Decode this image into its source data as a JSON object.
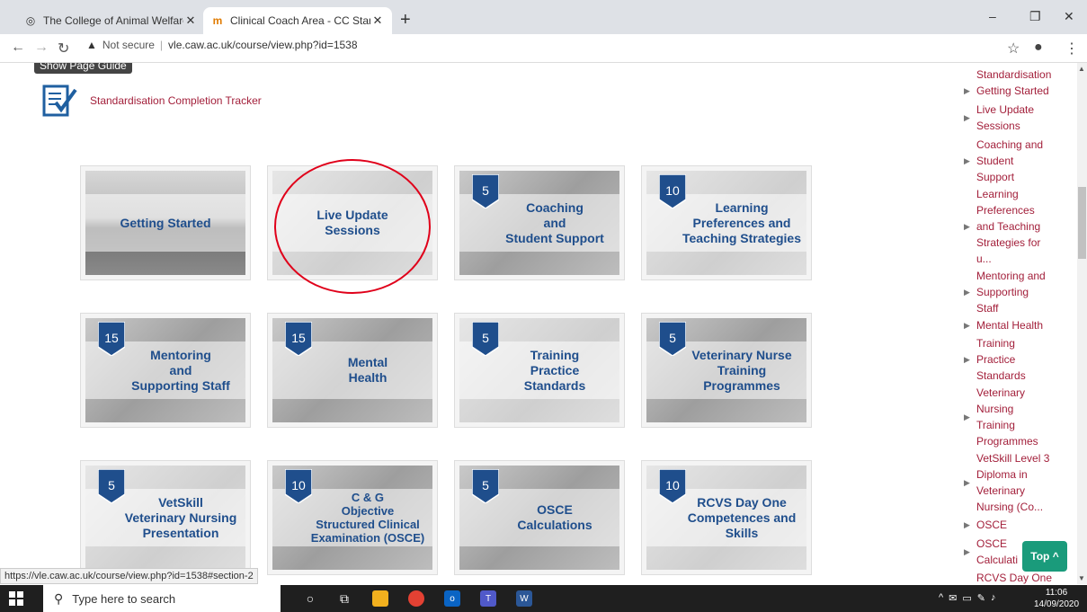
{
  "browser": {
    "tabs": [
      {
        "title": "The College of Animal Welfare",
        "active": false
      },
      {
        "title": "Clinical Coach Area - CC Standar",
        "active": true
      }
    ],
    "new_tab_label": "+",
    "minimize": "–",
    "maximize": "❐",
    "close": "✕",
    "security_label": "Not secure",
    "url": "vle.caw.ac.uk/course/view.php?id=1538"
  },
  "page": {
    "guide_tip": "Show Page Guide",
    "tracker_link": "Standardisation Completion Tracker",
    "tiles": [
      {
        "label": "Getting Started",
        "badge": ""
      },
      {
        "label": "Live Update\nSessions",
        "badge": ""
      },
      {
        "label": "Coaching\nand\nStudent Support",
        "badge": "5"
      },
      {
        "label": "Learning\nPreferences and\nTeaching Strategies",
        "badge": "10"
      },
      {
        "label": "Mentoring\nand\nSupporting Staff",
        "badge": "15"
      },
      {
        "label": "Mental\nHealth",
        "badge": "15"
      },
      {
        "label": "Training\nPractice\nStandards",
        "badge": "5"
      },
      {
        "label": "Veterinary Nurse\nTraining\nProgrammes",
        "badge": "5"
      },
      {
        "label": "VetSkill\nVeterinary Nursing\nPresentation",
        "badge": "5"
      },
      {
        "label": "C & G\nObjective\nStructured Clinical\nExamination (OSCE)",
        "badge": "10"
      },
      {
        "label": "OSCE\nCalculations",
        "badge": "5"
      },
      {
        "label": "RCVS Day One\nCompetences and\nSkills",
        "badge": "10"
      }
    ],
    "status_url": "https://vle.caw.ac.uk/course/view.php?id=1538#section-2",
    "top_button": "Top ^"
  },
  "sidebar": {
    "items": [
      {
        "label": "Standardisation",
        "arrow": false
      },
      {
        "label": "Getting Started",
        "arrow": true
      },
      {
        "label": "Live Update\nSessions",
        "arrow": true
      },
      {
        "label": "Coaching and\nStudent\nSupport",
        "arrow": true
      },
      {
        "label": "Learning\nPreferences\nand Teaching\nStrategies for\nu...",
        "arrow": true
      },
      {
        "label": "Mentoring and\nSupporting\nStaff",
        "arrow": true
      },
      {
        "label": "Mental Health",
        "arrow": true
      },
      {
        "label": "Training\nPractice\nStandards",
        "arrow": true
      },
      {
        "label": "Veterinary\nNursing\nTraining\nProgrammes",
        "arrow": true
      },
      {
        "label": "VetSkill Level 3\nDiploma in\nVeterinary\nNursing (Co...",
        "arrow": true
      },
      {
        "label": "OSCE",
        "arrow": true
      },
      {
        "label": "OSCE\nCalculati",
        "arrow": true
      },
      {
        "label": "RCVS Day One",
        "arrow": false
      }
    ]
  },
  "taskbar": {
    "search_placeholder": "Type here to search",
    "time": "11:06",
    "date": "14/09/2020"
  },
  "colors": {
    "link": "#a3203b",
    "tile_text": "#1f4e8c",
    "highlight_circle": "#e0001a",
    "top_button": "#1a9b7b"
  }
}
